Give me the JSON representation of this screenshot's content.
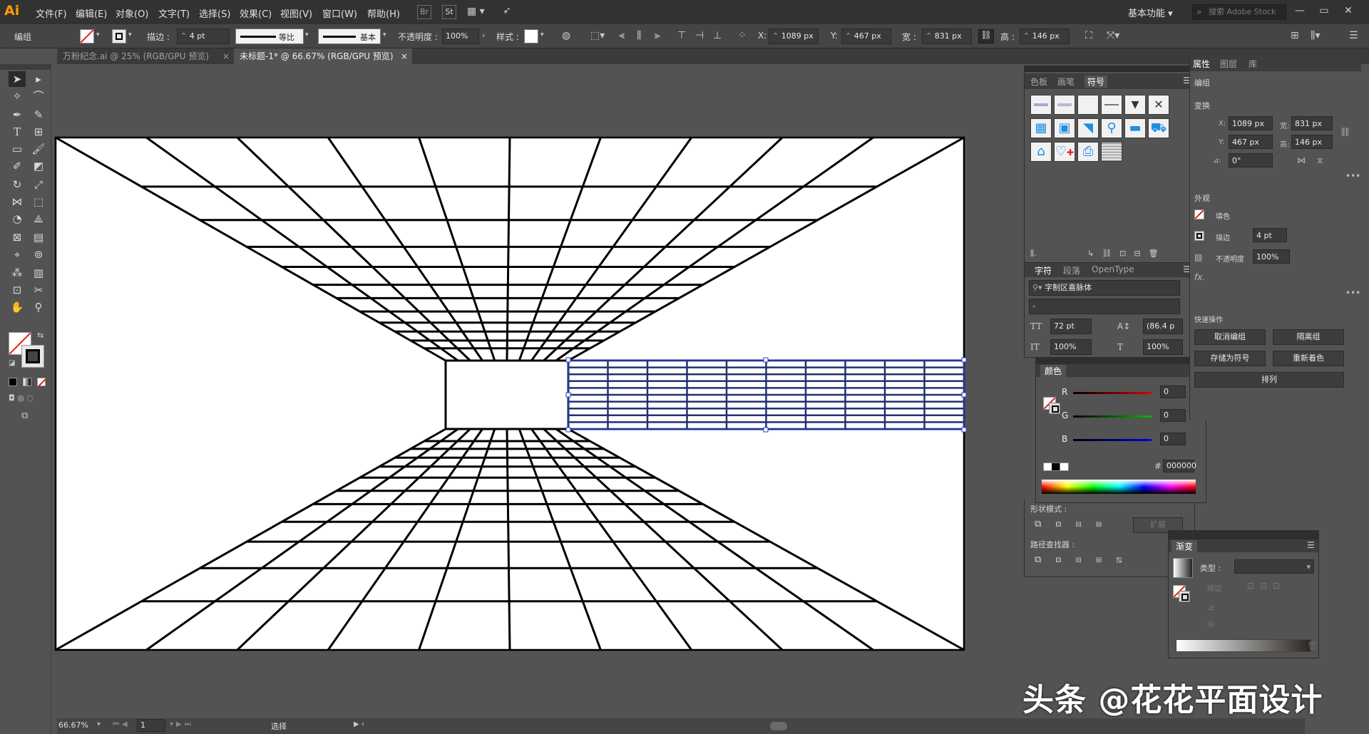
{
  "app": {
    "logo": "Ai"
  },
  "menu": [
    "文件(F)",
    "编辑(E)",
    "对象(O)",
    "文字(T)",
    "选择(S)",
    "效果(C)",
    "视图(V)",
    "窗口(W)",
    "帮助(H)"
  ],
  "menu_icons": {
    "bridge": "Br",
    "stock": "St"
  },
  "workspace": {
    "label": "基本功能",
    "search_placeholder": "搜索 Adobe Stock"
  },
  "window_buttons": {
    "minimize": "—",
    "maximize": "▭",
    "close": "✕"
  },
  "control": {
    "selection_type": "编组",
    "stroke_label": "描边 :",
    "stroke_value": "4 pt",
    "profile_label": "等比",
    "brush_label": "基本",
    "opacity_label": "不透明度 :",
    "opacity_value": "100%",
    "style_label": "样式 :",
    "x_label": "X:",
    "x_value": "1089 px",
    "y_label": "Y:",
    "y_value": "467 px",
    "w_label": "宽 :",
    "w_value": "831 px",
    "h_label": "高 :",
    "h_value": "146 px"
  },
  "tabs": [
    {
      "label": "万粉纪念.ai @ 25% (RGB/GPU 预览)",
      "close": "×"
    },
    {
      "label": "未标题-1* @ 66.67% (RGB/GPU 预览)",
      "close": "×"
    }
  ],
  "symbols_panel": {
    "tabs": [
      "色板",
      "画笔",
      "符号"
    ]
  },
  "char_panel": {
    "tabs": [
      "字符",
      "段落",
      "OpenType"
    ],
    "font": "字制区喜脉体",
    "style": "-",
    "size": "72 pt",
    "leading": "(86.4 p",
    "hscale": "100%",
    "vscale": "100%"
  },
  "color_panel": {
    "title": "颜色",
    "r_label": "R",
    "g_label": "G",
    "b_label": "B",
    "r": "0",
    "g": "0",
    "b": "0",
    "hex_label": "#",
    "hex": "000000"
  },
  "pathfinder": {
    "shape_modes": "形状模式 :",
    "expand": "扩展",
    "pathfinder_label": "路径查找器 :"
  },
  "gradient_panel": {
    "title": "渐变",
    "type_label": "类型 :",
    "stroke_label": "描边"
  },
  "properties": {
    "tabs": [
      "属性",
      "图层",
      "库"
    ],
    "group": "编组",
    "transform": "变换",
    "x_label": "X:",
    "x": "1089 px",
    "y_label": "Y:",
    "y": "467 px",
    "w_label": "宽:",
    "w": "831 px",
    "h_label": "高:",
    "h": "146 px",
    "angle_label": "⊿:",
    "angle": "0°",
    "appearance": "外观",
    "fill": "填色",
    "stroke": "描边",
    "stroke_value": "4 pt",
    "opacity": "不透明度",
    "opacity_value": "100%",
    "fx": "fx.",
    "quick_actions": "快速操作",
    "btn_ungroup": "取消编组",
    "btn_isolate": "隔离组",
    "btn_save_symbol": "存储为符号",
    "btn_recolor": "重新着色",
    "btn_arrange": "排列"
  },
  "status": {
    "zoom": "66.67%",
    "artboard": "1",
    "tool": "选择"
  },
  "watermark": "头条 @花花平面设计",
  "colors": {
    "accent": "#ff9a00",
    "selection": "#1f2fb0"
  }
}
